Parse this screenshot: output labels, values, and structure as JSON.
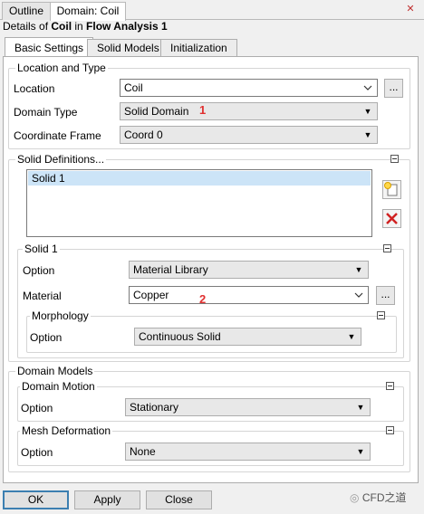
{
  "top_tabs": [
    "Outline",
    "Domain: Coil"
  ],
  "title": {
    "prefix": "Details of ",
    "object": "Coil",
    "mid": " in ",
    "analysis": "Flow Analysis 1"
  },
  "inner_tabs": [
    "Basic Settings",
    "Solid Models",
    "Initialization"
  ],
  "location_type": {
    "legend": "Location and Type",
    "location_label": "Location",
    "location_value": "Coil",
    "domain_type_label": "Domain Type",
    "domain_type_value": "Solid Domain",
    "coord_label": "Coordinate Frame",
    "coord_value": "Coord 0"
  },
  "solid_defs": {
    "legend": "Solid Definitions...",
    "items": [
      "Solid 1"
    ]
  },
  "solid1": {
    "legend": "Solid 1",
    "option_label": "Option",
    "option_value": "Material Library",
    "material_label": "Material",
    "material_value": "Copper",
    "morphology_legend": "Morphology",
    "morph_option_label": "Option",
    "morph_option_value": "Continuous Solid"
  },
  "domain_models": {
    "legend": "Domain Models",
    "motion_legend": "Domain Motion",
    "motion_option_label": "Option",
    "motion_option_value": "Stationary",
    "mesh_legend": "Mesh Deformation",
    "mesh_option_label": "Option",
    "mesh_option_value": "None"
  },
  "markers": [
    "1",
    "2"
  ],
  "buttons": {
    "ok": "OK",
    "apply": "Apply",
    "close": "Close"
  },
  "watermark": "CFD之道",
  "ellipsis": "..."
}
